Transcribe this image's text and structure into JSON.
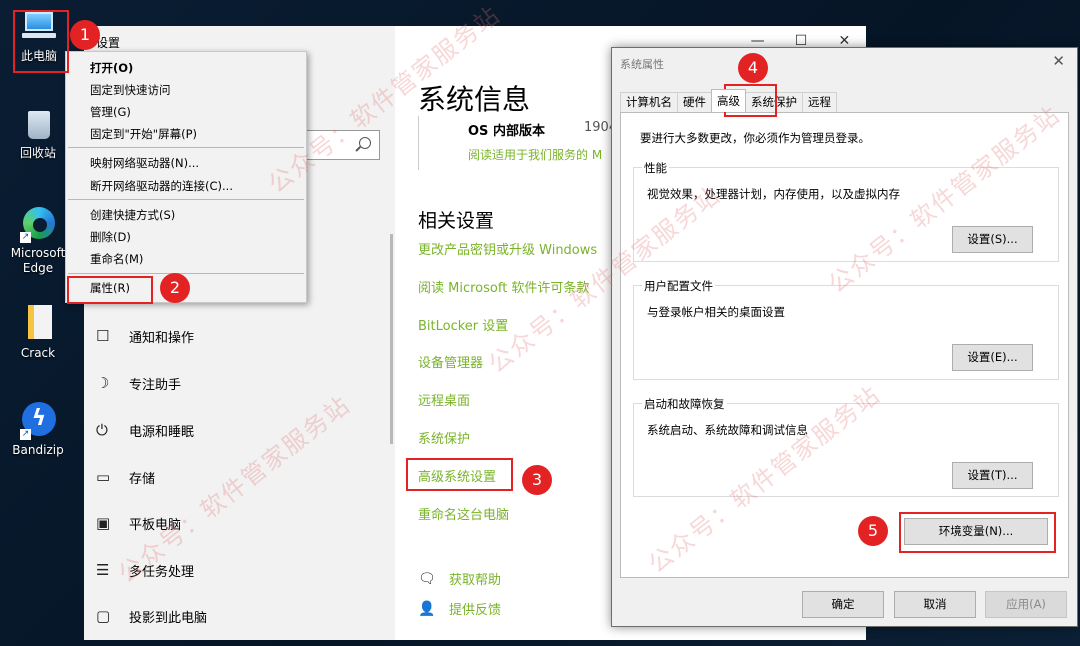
{
  "desktop": {
    "icons": [
      {
        "label": "此电脑"
      },
      {
        "label": "回收站"
      },
      {
        "label": "Microsoft Edge"
      },
      {
        "label": "Crack"
      },
      {
        "label": "Bandizip"
      }
    ]
  },
  "settings": {
    "window_title": "设置",
    "window_controls": {
      "minimize": "—",
      "maximize": "☐",
      "close": "✕"
    },
    "nav": [
      {
        "label": "通知和操作",
        "icon": "notification-icon",
        "glyph": "☐"
      },
      {
        "label": "专注助手",
        "icon": "moon-icon",
        "glyph": "☽"
      },
      {
        "label": "电源和睡眠",
        "icon": "power-icon",
        "glyph": "⏻"
      },
      {
        "label": "存储",
        "icon": "storage-icon",
        "glyph": "▭"
      },
      {
        "label": "平板电脑",
        "icon": "tablet-icon",
        "glyph": "▣"
      },
      {
        "label": "多任务处理",
        "icon": "multitask-icon",
        "glyph": "☰"
      },
      {
        "label": "投影到此电脑",
        "icon": "project-icon",
        "glyph": "▢"
      }
    ],
    "system_info": {
      "heading": "系统信息",
      "os_label": "OS 内部版本",
      "os_value": "1904",
      "os_link": "阅读适用于我们服务的 M"
    },
    "related": {
      "heading": "相关设置",
      "links": [
        "更改产品密钥或升级 Windows",
        "阅读 Microsoft 软件许可条款",
        "BitLocker 设置",
        "设备管理器",
        "远程桌面",
        "系统保护",
        "高级系统设置",
        "重命名这台电脑"
      ]
    },
    "help": {
      "get_help": "获取帮助",
      "feedback": "提供反馈"
    }
  },
  "context_menu": {
    "items": [
      "打开(O)",
      "固定到快速访问",
      "管理(G)",
      "固定到\"开始\"屏幕(P)",
      "映射网络驱动器(N)...",
      "断开网络驱动器的连接(C)...",
      "创建快捷方式(S)",
      "删除(D)",
      "重命名(M)",
      "属性(R)"
    ]
  },
  "dialog": {
    "title": "系统属性",
    "close": "✕",
    "tabs": [
      "计算机名",
      "硬件",
      "高级",
      "系统保护",
      "远程"
    ],
    "active_tab": "高级",
    "note": "要进行大多数更改，你必须作为管理员登录。",
    "groups": [
      {
        "title": "性能",
        "desc": "视觉效果，处理器计划，内存使用，以及虚拟内存",
        "button": "设置(S)..."
      },
      {
        "title": "用户配置文件",
        "desc": "与登录帐户相关的桌面设置",
        "button": "设置(E)..."
      },
      {
        "title": "启动和故障恢复",
        "desc": "系统启动、系统故障和调试信息",
        "button": "设置(T)..."
      }
    ],
    "env_button": "环境变量(N)...",
    "ok": "确定",
    "cancel": "取消",
    "apply": "应用(A)"
  },
  "annotations": [
    "1",
    "2",
    "3",
    "4",
    "5"
  ],
  "watermark": "公众号：软件管家服务站",
  "colors": {
    "link_green": "#7ab32a",
    "highlight_red": "#e32323"
  }
}
